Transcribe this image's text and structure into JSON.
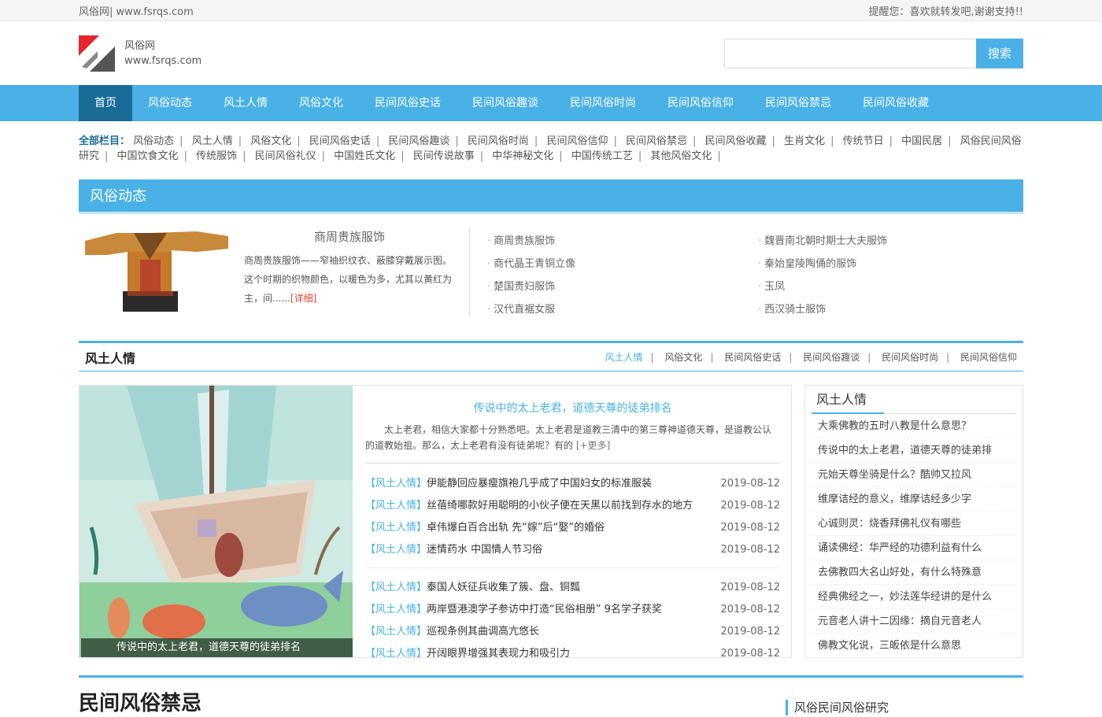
{
  "topbar": {
    "site": "风俗网| www.fsrqs.com",
    "notice": "提醒您：喜欢就转发吧,谢谢支持!!"
  },
  "header": {
    "logo_name": "风俗网",
    "logo_url_text": "www.fsrqs.com",
    "search_placeholder": "",
    "search_button": "搜索"
  },
  "nav": {
    "items": [
      "首页",
      "风俗动态",
      "风土人情",
      "风俗文化",
      "民间风俗史话",
      "民间风俗趣谈",
      "民间风俗时尚",
      "民间风俗信仰",
      "民间风俗禁忌",
      "民间风俗收藏"
    ]
  },
  "categories": {
    "label": "全部栏目：",
    "items": [
      "风俗动态",
      "风土人情",
      "风俗文化",
      "民间风俗史话",
      "民间风俗趣谈",
      "民间风俗时尚",
      "民间风俗信仰",
      "民间风俗禁忌",
      "民间风俗收藏",
      "生肖文化",
      "传统节日",
      "中国民居",
      "风俗民间风俗研究",
      "中国饮食文化",
      "传统服饰",
      "民间风俗礼仪",
      "中国姓氏文化",
      "民间传说故事",
      "中华神秘文化",
      "中国传统工艺",
      "其他风俗文化"
    ]
  },
  "section1": {
    "title": "风俗动态",
    "feature_title": "商周贵族服饰",
    "feature_text": "商周贵族服饰——窄袖织纹衣、蔽膝穿戴展示图。这个时期的织物颜色，以暖色为多，尤其以黄红为主，间......",
    "feature_more": "[详细]",
    "list_left": [
      "商周贵族服饰",
      "商代晶王青铜立像",
      "楚国贵妇服饰",
      "汉代直裾女服"
    ],
    "list_right": [
      "魏晋南北朝时期士大夫服饰",
      "秦始皇陵陶俑的服饰",
      "玉凤",
      "西汉骑士服饰"
    ]
  },
  "section2": {
    "title": "风土人情",
    "links": [
      "风土人情",
      "风俗文化",
      "民间风俗史话",
      "民间风俗趣谈",
      "民间风俗时尚",
      "民间风俗信仰"
    ],
    "pic_caption": "传说中的太上老君，道德天尊的徒弟排名",
    "head_title": "传说中的太上老君，道德天尊的徒弟排名",
    "head_desc": "太上老君，相信大家都十分熟悉吧。太上老君是道教三清中的第三尊神道德天尊，是道教公认的道教始祖。那么，太上老君有没有徒弟呢？有的",
    "head_more": "[+更多]",
    "news_a": [
      {
        "tag": "【风土人情】",
        "title": "伊能静回应暴瘦旗袍几乎成了中国妇女的标准服装",
        "date": "2019-08-12"
      },
      {
        "tag": "【风土人情】",
        "title": "丝蓓绮哪款好用聪明的小伙子便在天黑以前找到存水的地方",
        "date": "2019-08-12"
      },
      {
        "tag": "【风土人情】",
        "title": "卓伟爆白百合出轨 先“嫁”后“娶”的婚俗",
        "date": "2019-08-12"
      },
      {
        "tag": "【风土人情】",
        "title": "迷情药水 中国情人节习俗",
        "date": "2019-08-12"
      }
    ],
    "news_b": [
      {
        "tag": "【风土人情】",
        "title": "泰国人妖征兵收集了簇、盘、铜瓢",
        "date": "2019-08-12"
      },
      {
        "tag": "【风土人情】",
        "title": "两岸暨港澳学子参访中打造“民俗相册” 9名学子获奖",
        "date": "2019-08-12"
      },
      {
        "tag": "【风土人情】",
        "title": "巡视条例其曲调高亢悠长",
        "date": "2019-08-12"
      },
      {
        "tag": "【风土人情】",
        "title": "开阔眼界增强其表现力和吸引力",
        "date": "2019-08-12"
      }
    ],
    "side_title": "风土人情",
    "side_items": [
      "大乘佛教的五时八教是什么意思？",
      "传说中的太上老君，道德天尊的徒弟排",
      "元始天尊坐骑是什么？酷帅又拉风",
      "维摩诘经的意义，维摩诘经多少字",
      "心诚则灵：烧香拜佛礼仪有哪些",
      "诵读佛经：华严经的功德利益有什么",
      "去佛教四大名山好处，有什么特殊意",
      "经典佛经之一，妙法莲华经讲的是什么",
      "元音老人讲十二因缘：摘自元音老人",
      "佛教文化说，三皈依是什么意思"
    ]
  },
  "section3": {
    "title": "民间风俗禁忌",
    "right_title": "风俗民间风俗研究"
  },
  "colors": {
    "accent": "#49b1e6",
    "nav_active": "#1a6c96"
  }
}
